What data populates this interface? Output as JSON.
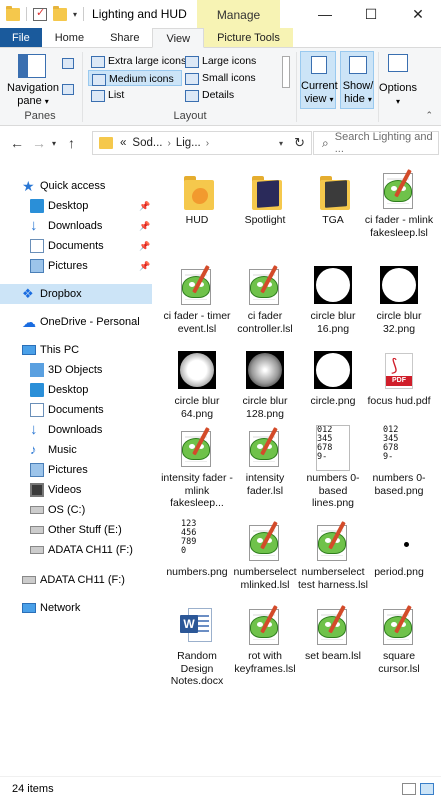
{
  "window": {
    "title": "Lighting and HUD",
    "context_tab_group": "Manage",
    "minimize_glyph": "—",
    "maximize_glyph": "☐",
    "close_glyph": "✕"
  },
  "ribbon_tabs": [
    {
      "label": "File"
    },
    {
      "label": "Home"
    },
    {
      "label": "Share"
    },
    {
      "label": "View"
    },
    {
      "label": "Picture Tools"
    }
  ],
  "ribbon": {
    "panes_group": {
      "navigation_pane_label_1": "Navigation",
      "navigation_pane_label_2": "pane",
      "group_label": "Panes"
    },
    "layout_group": {
      "items": [
        {
          "label": "Extra large icons"
        },
        {
          "label": "Large icons"
        },
        {
          "label": "Medium icons"
        },
        {
          "label": "Small icons"
        },
        {
          "label": "List"
        },
        {
          "label": "Details"
        }
      ],
      "selected": "Medium icons",
      "group_label": "Layout"
    },
    "current_view": {
      "label_1": "Current",
      "label_2": "view"
    },
    "show_hide": {
      "label_1": "Show/",
      "label_2": "hide"
    },
    "options": {
      "label": "Options"
    }
  },
  "address_bar": {
    "overflow": "«",
    "crumbs": [
      "Sod...",
      "Lig..."
    ],
    "search_placeholder": "Search Lighting and ..."
  },
  "nav_pane": {
    "items": [
      {
        "label": "Quick access",
        "icon": "star-icon"
      },
      {
        "label": "Desktop",
        "icon": "desktop-icon",
        "pinned": true
      },
      {
        "label": "Downloads",
        "icon": "download-icon",
        "pinned": true
      },
      {
        "label": "Documents",
        "icon": "documents-icon",
        "pinned": true
      },
      {
        "label": "Pictures",
        "icon": "pictures-icon",
        "pinned": true
      },
      {
        "label": "Dropbox",
        "icon": "dropbox-icon",
        "selected": true
      },
      {
        "label": "OneDrive - Personal",
        "icon": "onedrive-icon"
      },
      {
        "label": "This PC",
        "icon": "computer-icon"
      },
      {
        "label": "3D Objects",
        "icon": "3d-objects-icon"
      },
      {
        "label": "Desktop",
        "icon": "desktop-icon"
      },
      {
        "label": "Documents",
        "icon": "documents-icon"
      },
      {
        "label": "Downloads",
        "icon": "download-icon"
      },
      {
        "label": "Music",
        "icon": "music-icon"
      },
      {
        "label": "Pictures",
        "icon": "pictures-icon"
      },
      {
        "label": "Videos",
        "icon": "videos-icon"
      },
      {
        "label": "OS (C:)",
        "icon": "drive-icon"
      },
      {
        "label": "Other Stuff (E:)",
        "icon": "drive-icon"
      },
      {
        "label": "ADATA CH11 (F:)",
        "icon": "usb-drive-icon"
      },
      {
        "label": "ADATA CH11 (F:)",
        "icon": "usb-drive-icon"
      },
      {
        "label": "Network",
        "icon": "network-icon"
      }
    ]
  },
  "files": [
    {
      "name": "HUD",
      "type": "folder-blender"
    },
    {
      "name": "Spotlight",
      "type": "folder-dark"
    },
    {
      "name": "TGA",
      "type": "folder-black"
    },
    {
      "name": "ci fader - mlink fakesleep.lsl",
      "type": "lsl"
    },
    {
      "name": "ci fader - timer event.lsl",
      "type": "lsl"
    },
    {
      "name": "ci fader controller.lsl",
      "type": "lsl"
    },
    {
      "name": "circle blur 16.png",
      "type": "blur16"
    },
    {
      "name": "circle blur 32.png",
      "type": "blur32"
    },
    {
      "name": "circle blur 64.png",
      "type": "blur64"
    },
    {
      "name": "circle blur 128.png",
      "type": "blur128"
    },
    {
      "name": "circle.png",
      "type": "circle"
    },
    {
      "name": "focus hud.pdf",
      "type": "pdf"
    },
    {
      "name": "intensity fader - mlink fakesleep...",
      "type": "lsl"
    },
    {
      "name": "intensity fader.lsl",
      "type": "lsl"
    },
    {
      "name": "numbers 0-based lines.png",
      "type": "nums-grid"
    },
    {
      "name": "numbers 0-based.png",
      "type": "nums"
    },
    {
      "name": "numbers.png",
      "type": "nums1"
    },
    {
      "name": "numberselect mlinked.lsl",
      "type": "lsl"
    },
    {
      "name": "numberselect test harness.lsl",
      "type": "lsl"
    },
    {
      "name": "period.png",
      "type": "period"
    },
    {
      "name": "Random Design Notes.docx",
      "type": "docx"
    },
    {
      "name": "rot with keyframes.lsl",
      "type": "lsl"
    },
    {
      "name": "set beam.lsl",
      "type": "lsl"
    },
    {
      "name": "square cursor.lsl",
      "type": "lsl"
    }
  ],
  "number_thumbs": {
    "nums_grid": "012\n345\n678\n9- ",
    "nums": "012\n345\n678\n9-",
    "nums1": "123\n456\n789\n0"
  },
  "pdf_tag": "PDF",
  "docx_badge": "W",
  "status": {
    "item_count": "24 items"
  }
}
